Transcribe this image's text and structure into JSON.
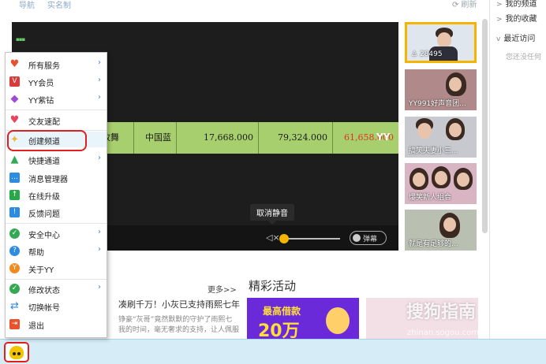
{
  "nav": {
    "tabs": [
      "导航",
      "实名制"
    ],
    "refresh": "刷新"
  },
  "right_panel": {
    "items": [
      {
        "label": "我的频道",
        "chevron": ">"
      },
      {
        "label": "我的收藏",
        "chevron": ">"
      },
      {
        "label": "最近访问",
        "chevron": "v"
      }
    ],
    "empty_text": "您还没任何"
  },
  "video": {
    "table_cells": [
      "故舞",
      "中国蓝",
      "17,668.000",
      "79,324.000",
      "61,658.000"
    ],
    "mark": "YY",
    "tooltip": "取消静音",
    "mute_symbol": "◁×",
    "volume": 0.0,
    "danmu_label": "弹幕"
  },
  "thumbnails": [
    {
      "caption": "28495",
      "views_icon": "person-icon",
      "selected": true
    },
    {
      "caption": "YY991好声音团..."
    },
    {
      "caption": "搞笑夫妻小三..."
    },
    {
      "caption": "爆笑新人组合"
    },
    {
      "caption": "就是有足够的..."
    }
  ],
  "news": {
    "more": "更多>>",
    "headline": "凑刷千万！小灰已支持雨熙七年",
    "line2": "铮豪“灰哥”竟然默默的守护了雨熙七",
    "line3": "我的时间，毫无奢求的支持，让人佩服"
  },
  "activities": {
    "title": "精彩活动",
    "banner1_l1": "最高借款",
    "banner1_l2": "20万"
  },
  "watermark": {
    "main": "搜狗指南",
    "sub": "zhinan.sogou.com"
  },
  "menu": {
    "items": [
      {
        "label": "所有服务",
        "icon": "heart-icon",
        "color": "#e8532d",
        "submenu": true
      },
      {
        "label": "YY会员",
        "icon": "vip-icon",
        "color": "#d93a3a",
        "submenu": true
      },
      {
        "label": "YY紫钻",
        "icon": "diamond-icon",
        "color": "#a04bd6",
        "submenu": true
      },
      {
        "label": "交友速配",
        "icon": "match-heart-icon",
        "color": "#e8445b",
        "submenu": false
      },
      {
        "label": "创建频道",
        "icon": "create-channel-icon",
        "color": "#f2b632",
        "submenu": false
      },
      {
        "label": "快捷通道",
        "icon": "shortcut-icon",
        "color": "#35a853",
        "submenu": true
      },
      {
        "label": "消息管理器",
        "icon": "message-icon",
        "color": "#2d8be0",
        "submenu": false
      },
      {
        "label": "在线升级",
        "icon": "upgrade-icon",
        "color": "#29a84a",
        "submenu": false
      },
      {
        "label": "反馈问题",
        "icon": "feedback-icon",
        "color": "#2d8be0",
        "submenu": false
      },
      {
        "label": "安全中心",
        "icon": "shield-icon",
        "color": "#35a853",
        "submenu": true
      },
      {
        "label": "帮助",
        "icon": "help-icon",
        "color": "#2d8be0",
        "submenu": true
      },
      {
        "label": "关于YY",
        "icon": "about-icon",
        "color": "#f28b1d",
        "submenu": false
      },
      {
        "label": "修改状态",
        "icon": "status-icon",
        "color": "#35a853",
        "submenu": true
      },
      {
        "label": "切换帐号",
        "icon": "switch-icon",
        "color": "#2d8be0",
        "submenu": false
      },
      {
        "label": "退出",
        "icon": "exit-icon",
        "color": "#e8532d",
        "submenu": false
      }
    ]
  },
  "colors": {
    "accent": "#f5b400",
    "highlight": "#e02020",
    "statusbar": "#d6ecf6",
    "video_table": "#a8cf6e"
  }
}
